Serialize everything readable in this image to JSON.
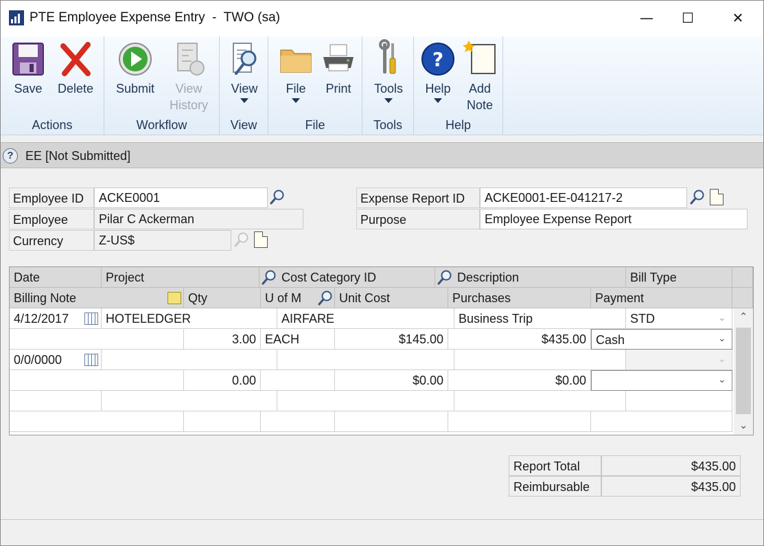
{
  "window": {
    "title": "PTE Employee Expense Entry  -  TWO (sa)",
    "minimize": "—",
    "maximize": "☐",
    "close": "✕"
  },
  "ribbon": {
    "groups": {
      "actions": "Actions",
      "workflow": "Workflow",
      "view": "View",
      "file": "File",
      "tools": "Tools",
      "help": "Help"
    },
    "buttons": {
      "save": "Save",
      "delete": "Delete",
      "submit": "Submit",
      "view_history_1": "View",
      "view_history_2": "History",
      "view": "View",
      "file": "File",
      "print": "Print",
      "tools": "Tools",
      "help": "Help",
      "add_note_1": "Add",
      "add_note_2": "Note"
    }
  },
  "status": {
    "text": "EE [Not Submitted]"
  },
  "form": {
    "employee_id_label": "Employee ID",
    "employee_id": "ACKE0001",
    "employee_label": "Employee",
    "employee": "Pilar C Ackerman",
    "currency_label": "Currency",
    "currency": "Z-US$",
    "expense_report_id_label": "Expense Report ID",
    "expense_report_id": "ACKE0001-EE-041217-2",
    "purpose_label": "Purpose",
    "purpose": "Employee Expense Report"
  },
  "grid": {
    "headers_row1": {
      "date": "Date",
      "project": "Project",
      "cost_category_id": "Cost Category ID",
      "description": "Description",
      "bill_type": "Bill Type"
    },
    "headers_row2": {
      "billing_note": "Billing Note",
      "qty": "Qty",
      "u_of_m": "U of M",
      "unit_cost": "Unit Cost",
      "purchases": "Purchases",
      "payment": "Payment"
    },
    "rows": [
      {
        "date": "4/12/2017",
        "project": "HOTELEDGER",
        "cost_category": "AIRFARE",
        "description": "Business Trip",
        "bill_type": "STD",
        "billing_note": "",
        "qty": "3.00",
        "u_of_m": "EACH",
        "unit_cost": "$145.00",
        "purchases": "$435.00",
        "payment": "Cash"
      },
      {
        "date": "0/0/0000",
        "project": "",
        "cost_category": "",
        "description": "",
        "bill_type": "",
        "billing_note": "",
        "qty": "0.00",
        "u_of_m": "",
        "unit_cost": "$0.00",
        "purchases": "$0.00",
        "payment": ""
      }
    ]
  },
  "totals": {
    "report_total_label": "Report Total",
    "report_total": "$435.00",
    "reimbursable_label": "Reimbursable",
    "reimbursable": "$435.00"
  }
}
